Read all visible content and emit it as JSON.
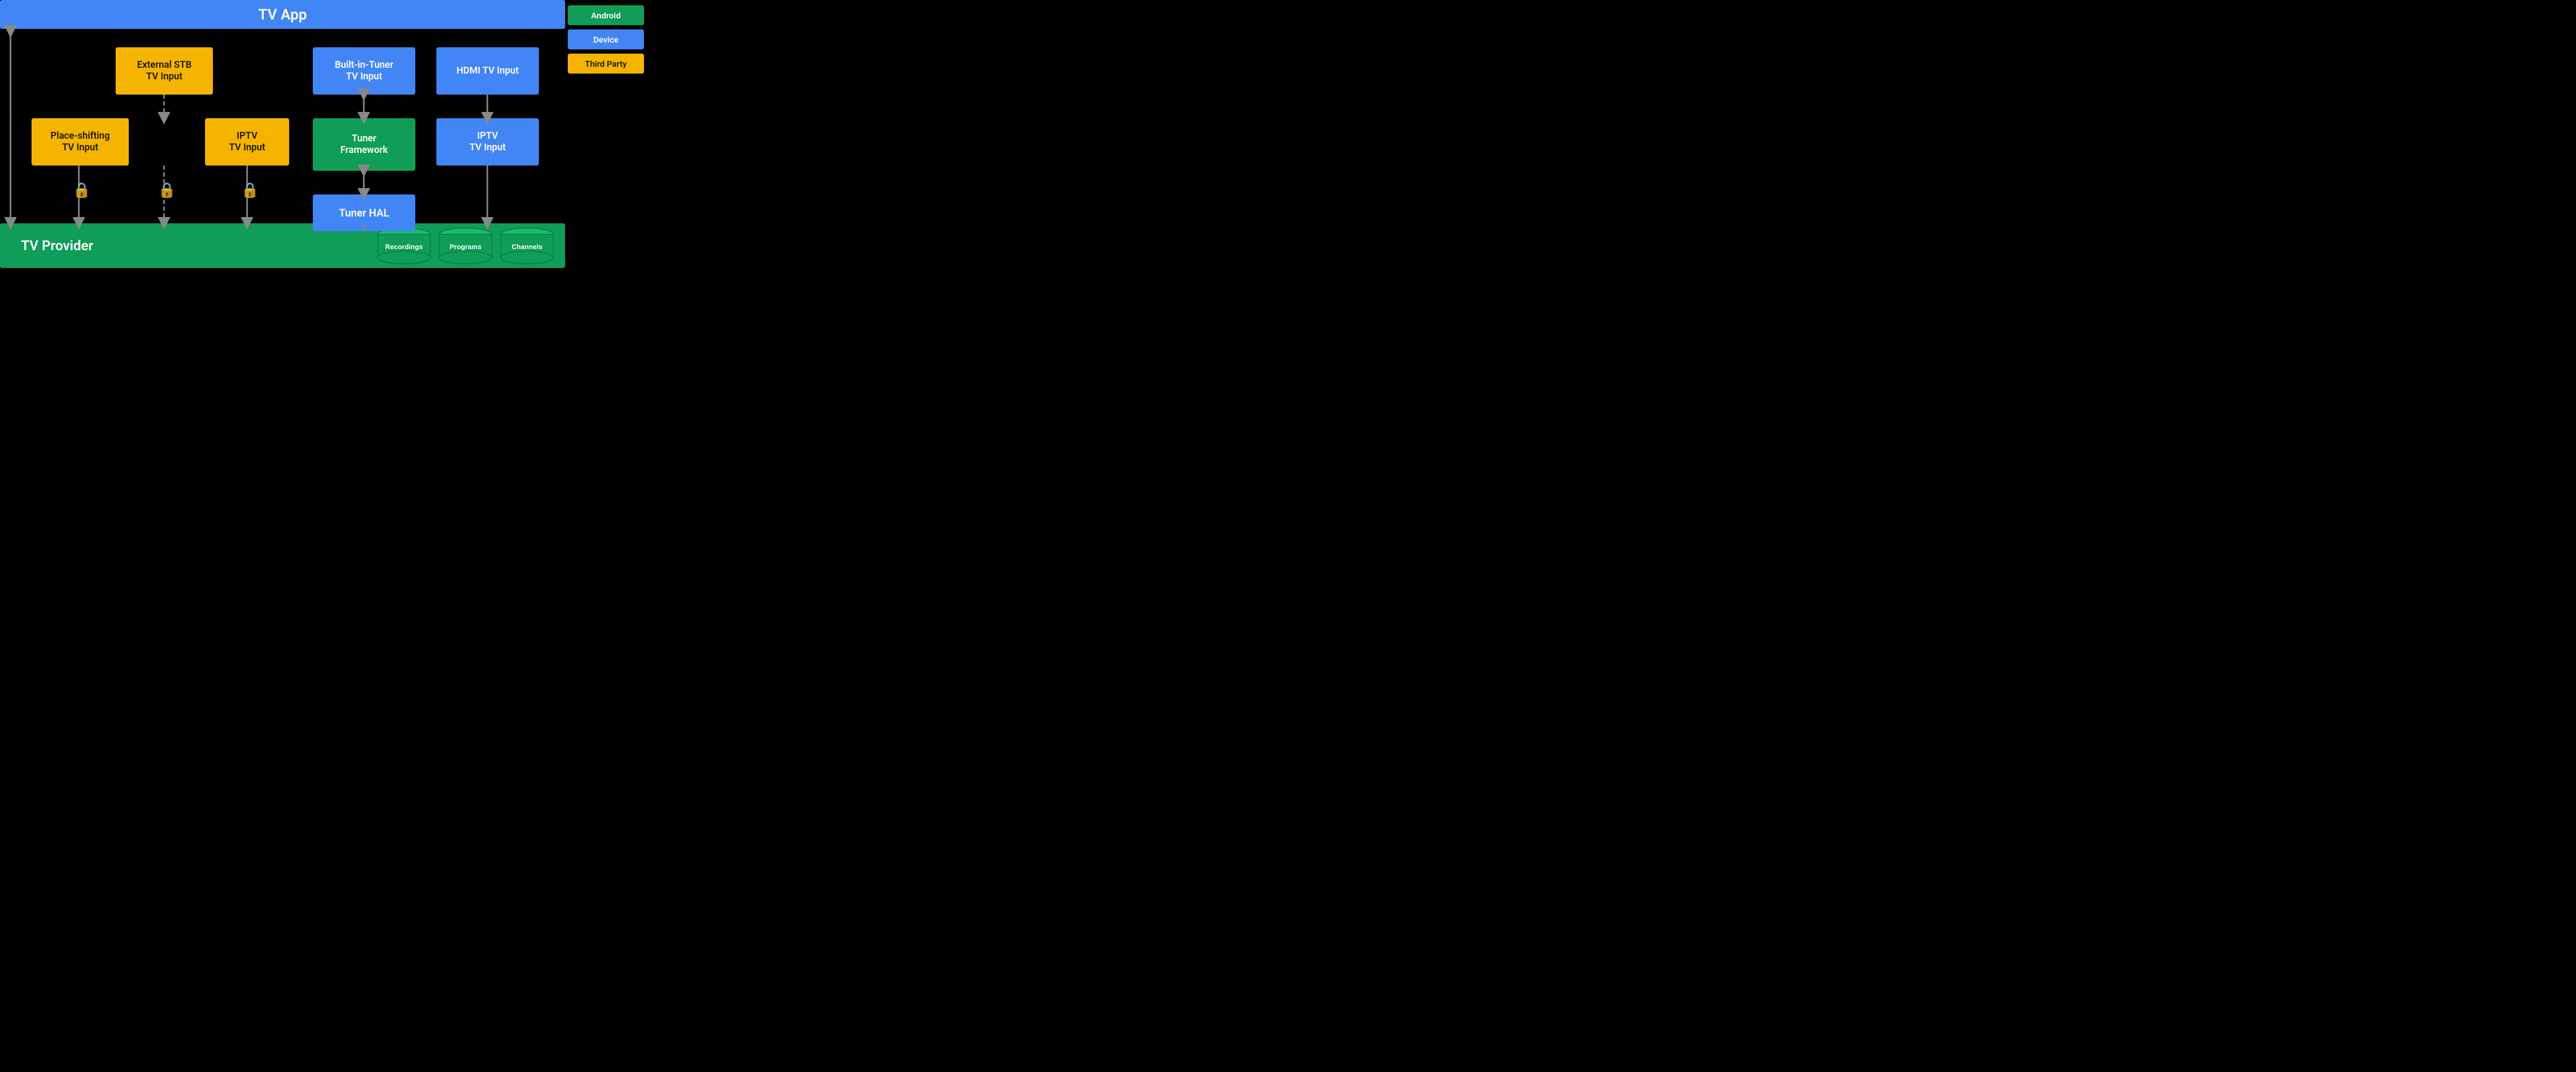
{
  "header": {
    "tv_app_label": "TV App"
  },
  "footer": {
    "tv_provider_label": "TV Provider"
  },
  "legend": {
    "android": "Android",
    "device": "Device",
    "third_party": "Third Party"
  },
  "boxes": {
    "external_stb": "External STB\nTV Input",
    "place_shifting": "Place-shifting\nTV Input",
    "iptv_left": "IPTV\nTV Input",
    "built_in_tuner": "Built-in-Tuner\nTV Input",
    "tuner_framework": "Tuner\nFramework",
    "tuner_hal": "Tuner HAL",
    "hdmi_tv_input": "HDMI TV Input",
    "iptv_right": "IPTV\nTV Input"
  },
  "cylinders": {
    "recordings": "Recordings",
    "programs": "Programs",
    "channels": "Channels"
  },
  "colors": {
    "orange": "#F4B400",
    "blue": "#4285F4",
    "green": "#0F9D58",
    "black": "#000000",
    "white": "#ffffff"
  }
}
